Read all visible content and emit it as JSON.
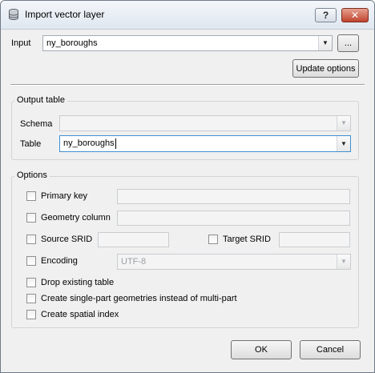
{
  "window": {
    "title": "Import vector layer",
    "help_label": "?",
    "close_label": "✕"
  },
  "input": {
    "label": "Input",
    "value": "ny_boroughs",
    "browse_label": "...",
    "update_label": "Update options"
  },
  "output_table": {
    "title": "Output table",
    "schema_label": "Schema",
    "schema_value": "",
    "table_label": "Table",
    "table_value": "ny_boroughs"
  },
  "options": {
    "title": "Options",
    "primary_key": {
      "label": "Primary key",
      "checked": false,
      "value": ""
    },
    "geometry_column": {
      "label": "Geometry column",
      "checked": false,
      "value": ""
    },
    "source_srid": {
      "label": "Source SRID",
      "checked": false,
      "value": ""
    },
    "target_srid": {
      "label": "Target SRID",
      "checked": false,
      "value": ""
    },
    "encoding": {
      "label": "Encoding",
      "checked": false,
      "value": "UTF-8"
    },
    "drop_existing": {
      "label": "Drop existing table",
      "checked": false
    },
    "single_part": {
      "label": "Create single-part geometries instead of multi-part",
      "checked": false
    },
    "spatial_index": {
      "label": "Create spatial index",
      "checked": false
    }
  },
  "buttons": {
    "ok": "OK",
    "cancel": "Cancel"
  }
}
